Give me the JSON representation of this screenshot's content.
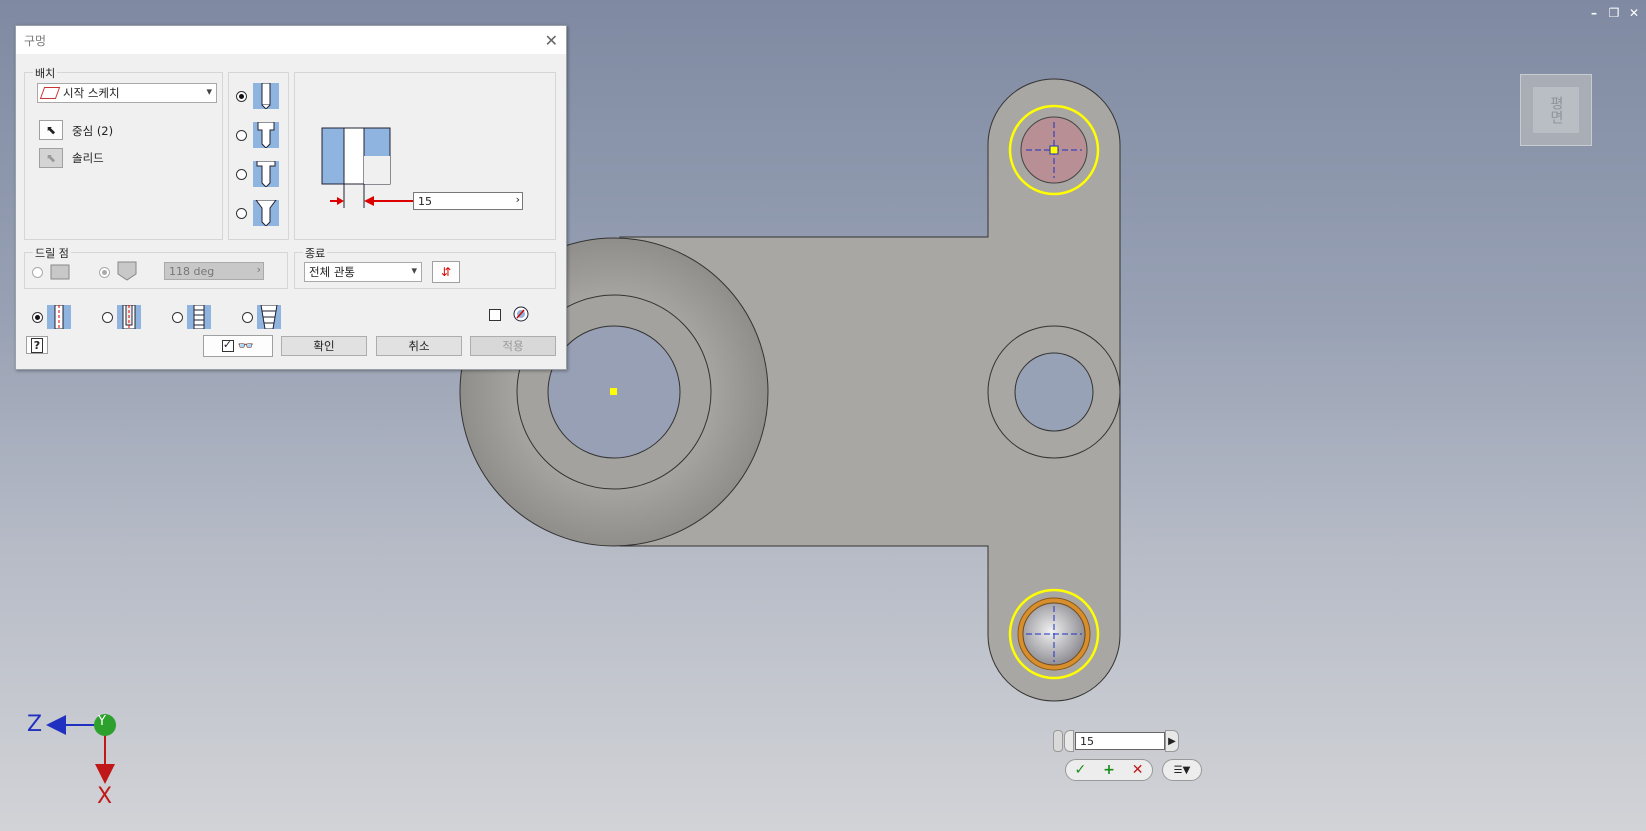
{
  "window_controls": {
    "minimize": "–",
    "restore": "❐",
    "close": "✕"
  },
  "viewcube": {
    "face_label": "평면"
  },
  "dialog": {
    "title": "구멍",
    "placement": {
      "label": "배치",
      "selected": "시작 스케치",
      "center_label": "중심 (2)",
      "solid_label": "솔리드"
    },
    "diameter_value": "15",
    "drill_point": {
      "label": "드릴 점",
      "angle_value": "118 deg"
    },
    "termination": {
      "label": "종료",
      "selected": "전체 관통"
    },
    "buttons": {
      "ok": "확인",
      "cancel": "취소",
      "apply": "적용"
    }
  },
  "mini_toolbar": {
    "value": "15"
  },
  "axes": {
    "z": "Z",
    "y": "Y",
    "x": "X"
  },
  "colors": {
    "accent_yellow": "#ffff00",
    "hole_highlight": "#cf8f8f",
    "axis_z": "#2030c0",
    "axis_y": "#2ea02e",
    "axis_x": "#c01818"
  }
}
